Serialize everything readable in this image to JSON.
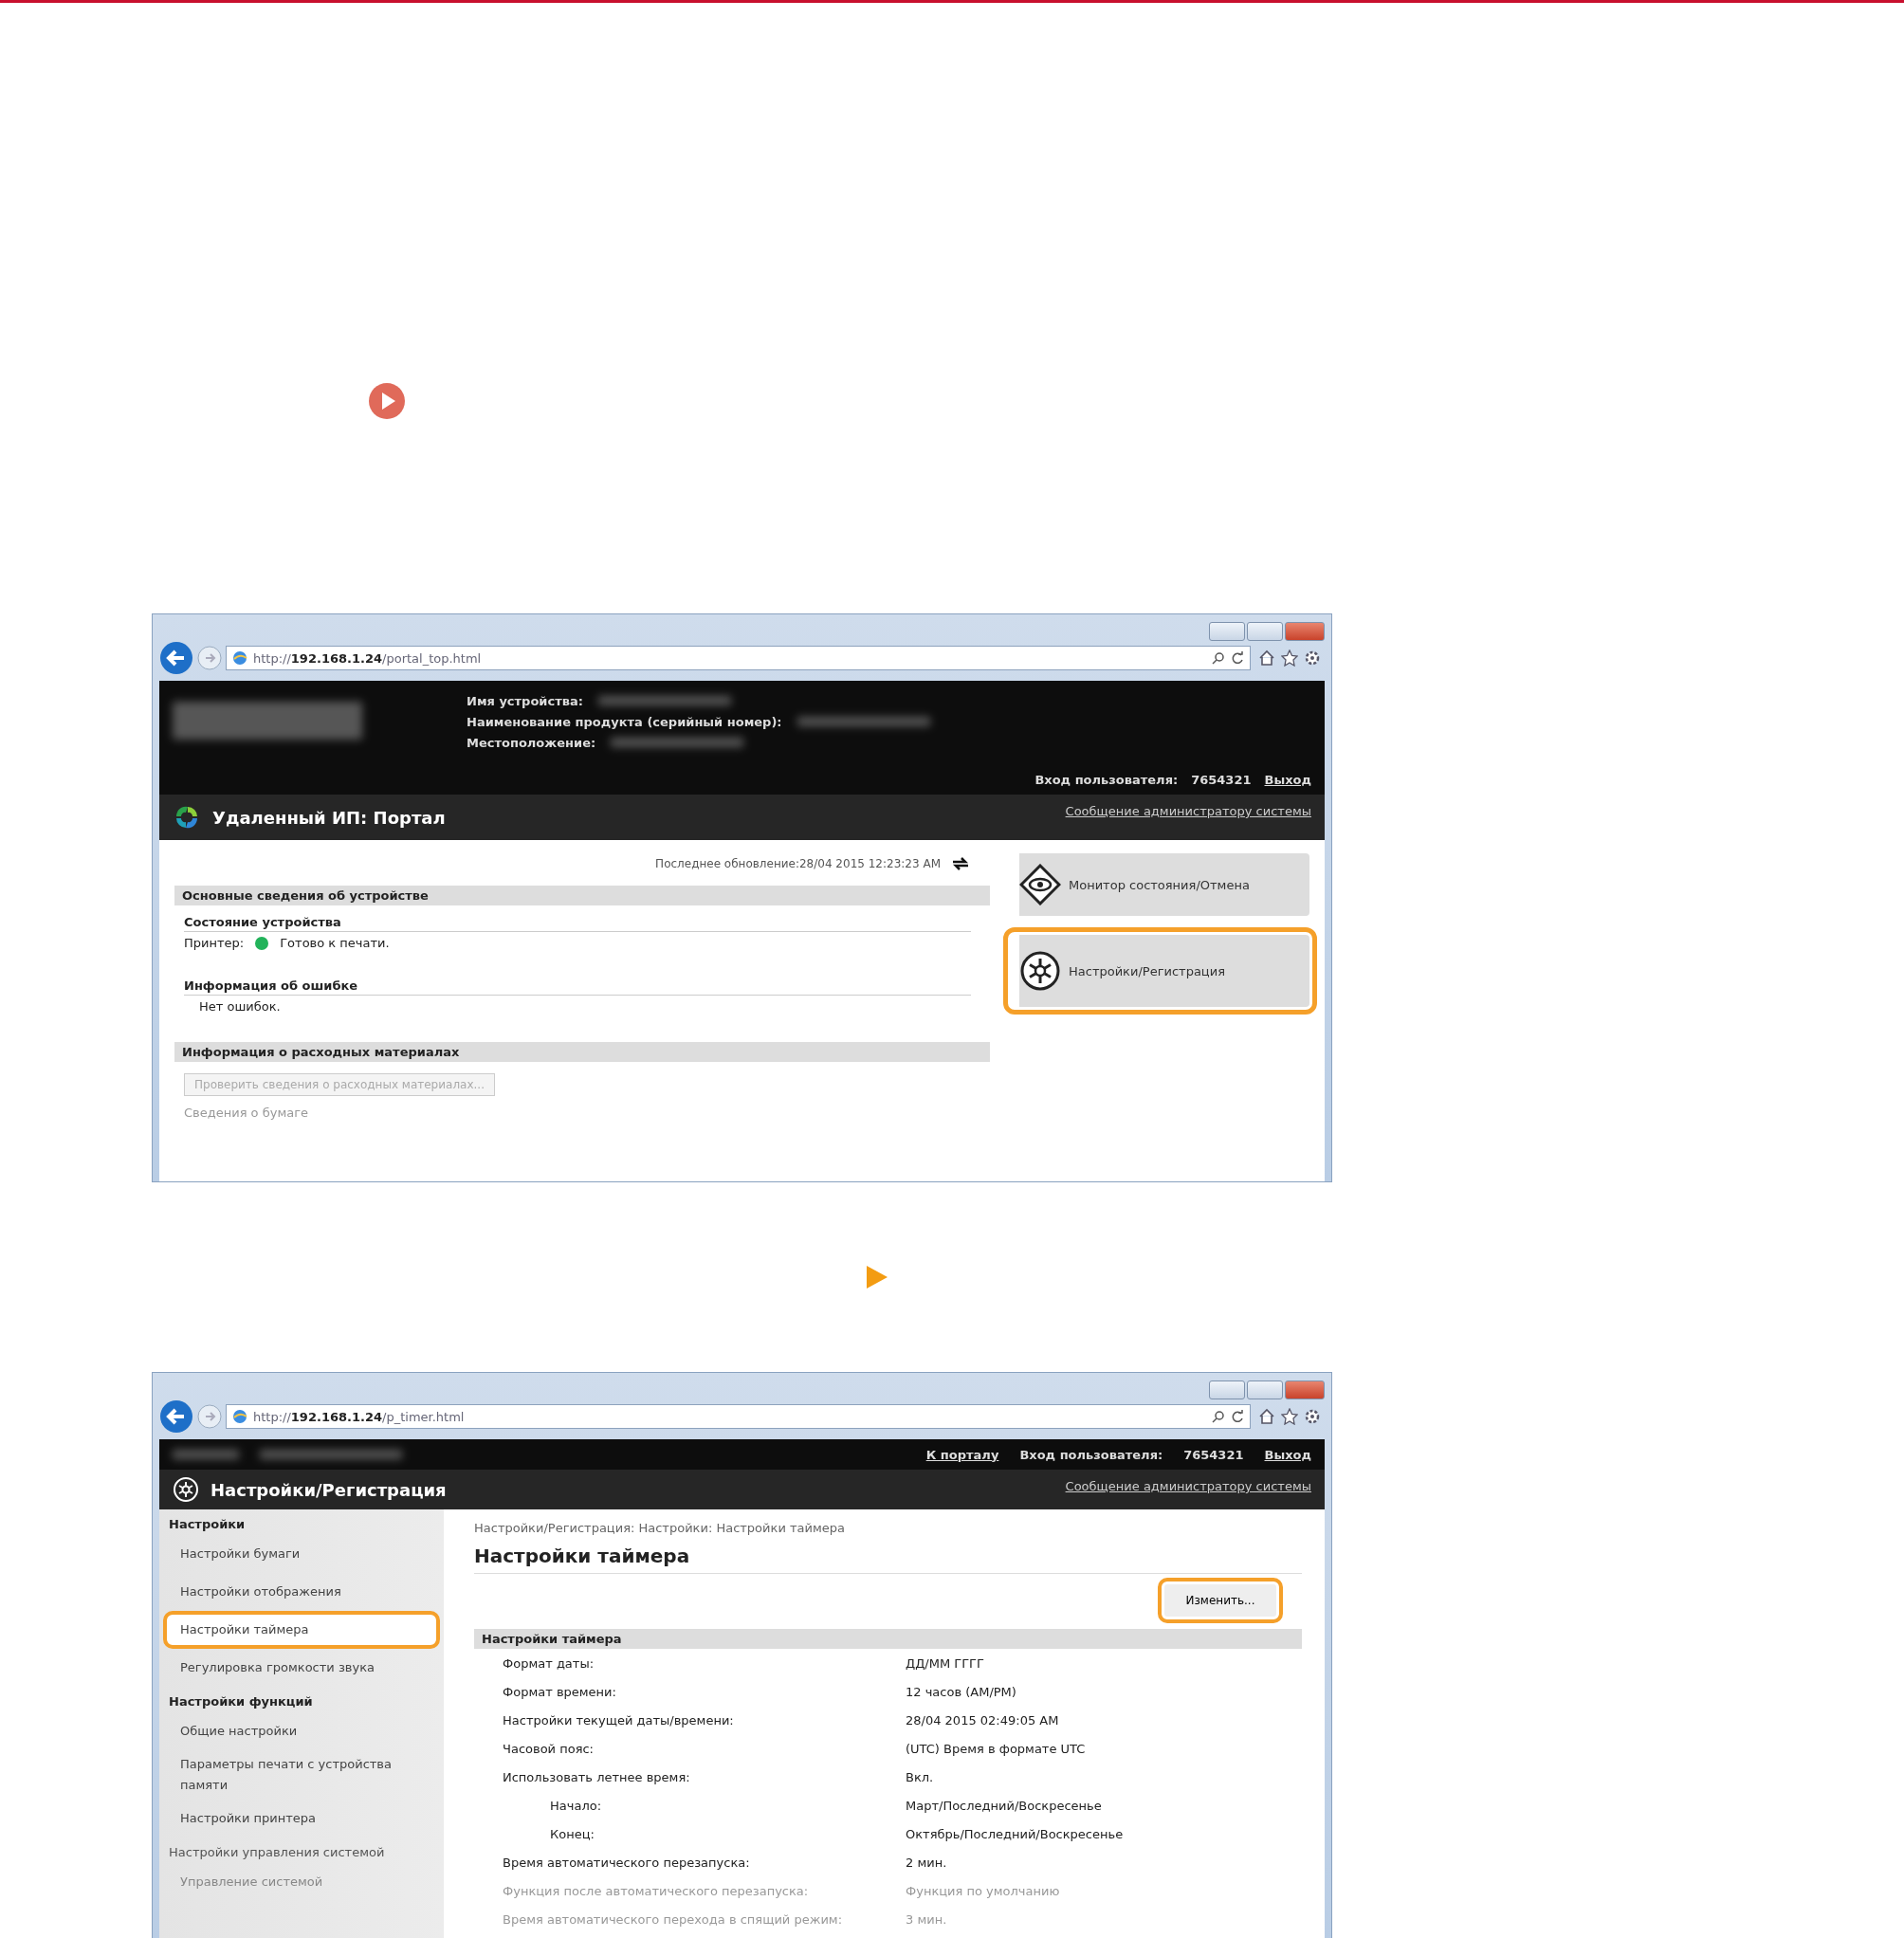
{
  "portal_screenshot": {
    "browser": {
      "url": "http://**192.168.1.24**/portal_top.html"
    },
    "header": {
      "fields": [
        {
          "label": "Имя устройства:"
        },
        {
          "label": "Наименование продукта (серийный номер):"
        },
        {
          "label": "Местоположение:"
        }
      ],
      "login_label": "Вход пользователя:",
      "user": "7654321",
      "logout": "Выход"
    },
    "title": "Удаленный ИП: Портал",
    "admin_link": "Сообщение администратору системы",
    "last_update": "Последнее обновление:28/04 2015 12:23:23 AM",
    "sections": [
      {
        "title": "Основные сведения об устройстве",
        "groups": [
          {
            "title": "Состояние устройства",
            "rows": [
              {
                "kind": "status",
                "label": "Принтер:",
                "status": "Готово к печати.",
                "color": "#22b35a"
              }
            ]
          },
          {
            "title": "Информация об ошибке",
            "rows": [
              {
                "kind": "text",
                "text": "Нет ошибок."
              }
            ]
          }
        ]
      },
      {
        "title": "Информация о расходных материалах",
        "button": {
          "label": "Проверить сведения о расходных материалах...",
          "disabled": true
        },
        "note": "Сведения о бумаге"
      }
    ],
    "side_buttons": [
      {
        "kind": "eye",
        "label": "Монитор состояния/Отмена",
        "highlighted": false
      },
      {
        "kind": "gear",
        "label": "Настройки/Регистрация",
        "highlighted": true
      }
    ]
  },
  "settings_screenshot": {
    "browser": {
      "url": "http://**192.168.1.24**/p_timer.html"
    },
    "top_links": {
      "portal": "К порталу",
      "login_label": "Вход пользователя:",
      "user": "7654321",
      "logout": "Выход"
    },
    "title": "Настройки/Регистрация",
    "admin_link": "Сообщение администратору системы",
    "sidebar": [
      {
        "title": "Настройки",
        "items": [
          {
            "label": "Настройки бумаги",
            "highlighted": false,
            "faded": false
          },
          {
            "label": "Настройки отображения",
            "highlighted": false,
            "faded": false
          },
          {
            "label": "Настройки таймера",
            "highlighted": true,
            "faded": false
          },
          {
            "label": "Регулировка громкости звука",
            "highlighted": false,
            "faded": false
          }
        ]
      },
      {
        "title": "Настройки функций",
        "items": [
          {
            "label": "Общие настройки",
            "highlighted": false,
            "faded": false
          },
          {
            "label": "Параметры печати с устройства памяти",
            "highlighted": false,
            "faded": false
          },
          {
            "label": "Настройки принтера",
            "highlighted": false,
            "faded": false
          }
        ]
      },
      {
        "title": "Настройки управления системой",
        "items": [
          {
            "label": "Управление системой",
            "highlighted": false,
            "faded": true
          }
        ]
      }
    ],
    "breadcrumb": "Настройки/Регистрация: Настройки: Настройки таймера",
    "heading": "Настройки таймера",
    "edit_button": {
      "label": "Изменить...",
      "highlighted": true
    },
    "table": {
      "title": "Настройки таймера",
      "rows": [
        {
          "label": "Формат даты:",
          "value": "ДД/ММ ГГГГ",
          "faded": false
        },
        {
          "label": "Формат времени:",
          "value": "12 часов (AM/PM)",
          "faded": false
        },
        {
          "label": "Настройки текущей даты/времени:",
          "value": "28/04 2015 02:49:05 AM",
          "faded": false
        },
        {
          "label": "Часовой пояс:",
          "value": "(UTC) Время в формате UTC",
          "faded": false
        },
        {
          "label": "Использовать летнее время:",
          "value": "Вкл.",
          "faded": false,
          "children": [
            {
              "label": "Начало:",
              "value": "Март/Последний/Воскресенье",
              "faded": false
            },
            {
              "label": "Конец:",
              "value": "Октябрь/Последний/Воскресенье",
              "faded": false
            }
          ]
        },
        {
          "label": "Время автоматического перезапуска:",
          "value": "2 мин.",
          "faded": false
        },
        {
          "label": "Функция после автоматического перезапуска:",
          "value": "Функция по умолчанию",
          "faded": true
        },
        {
          "label": "Время автоматического перехода в спящий режим:",
          "value": "3 мин.",
          "faded": true
        }
      ]
    }
  }
}
